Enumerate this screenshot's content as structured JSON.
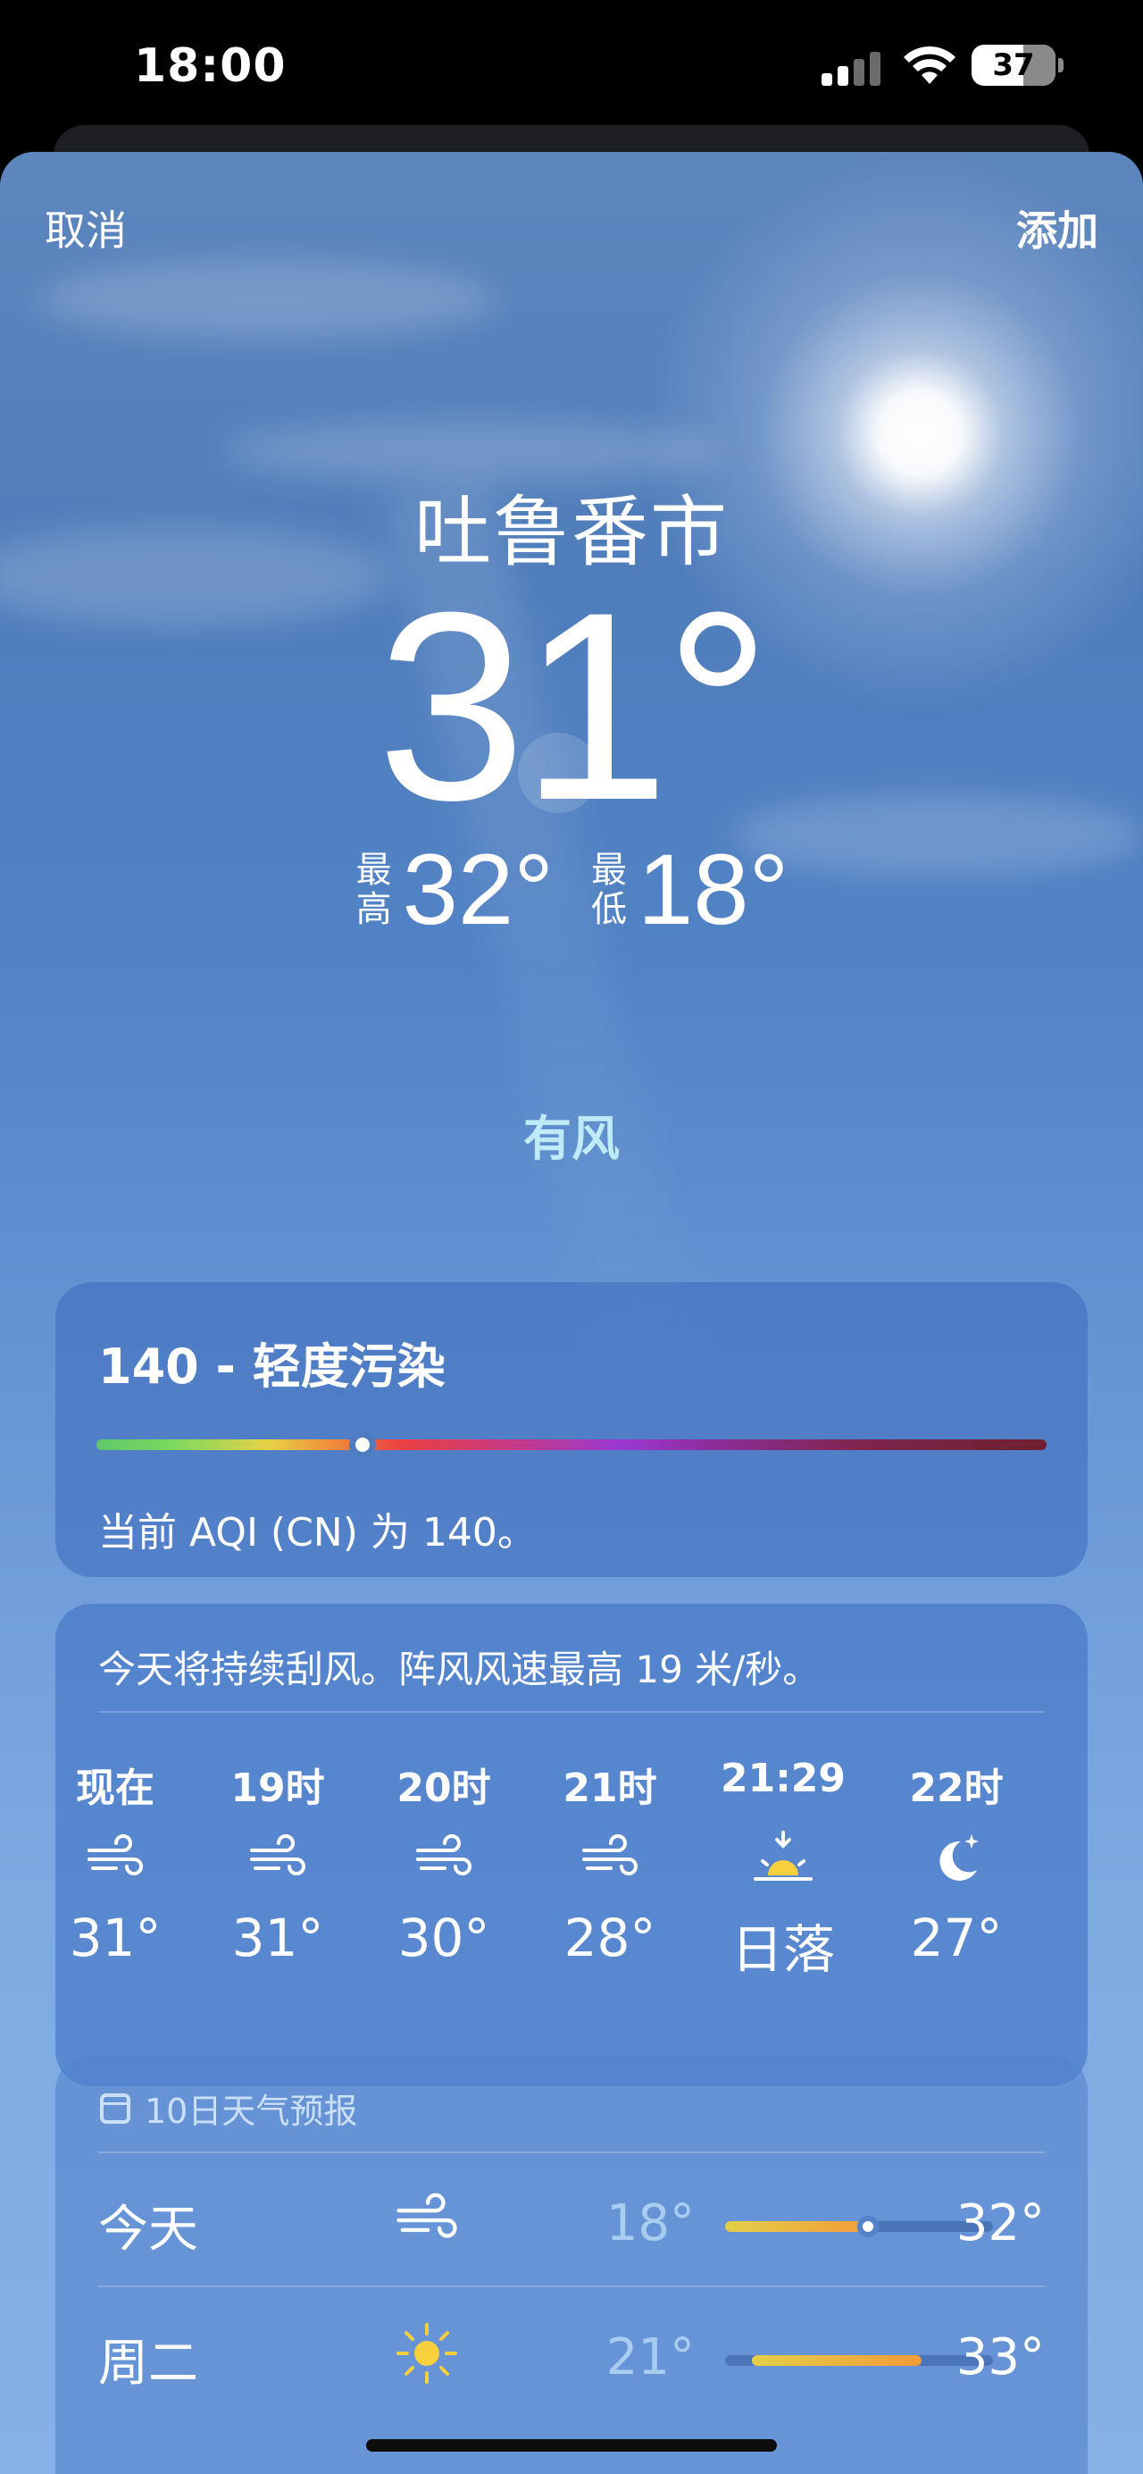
{
  "status_bar": {
    "time": "18:00",
    "battery": "37"
  },
  "nav": {
    "cancel": "取消",
    "add": "添加"
  },
  "location": {
    "city": "吐鲁番市",
    "temperature": "31°",
    "high_label": "最高",
    "high": "32°",
    "low_label": "最低",
    "low": "18°",
    "condition": "有风"
  },
  "aqi": {
    "title": "140 - 轻度污染",
    "description": "当前 AQI (CN) 为 140。",
    "level": 0.28
  },
  "hourly": {
    "summary": "今天将持续刮风。阵风风速最高 19 米/秒。",
    "items": [
      {
        "time": "现在",
        "icon": "wind-icon",
        "temp": "31°"
      },
      {
        "time": "19时",
        "icon": "wind-icon",
        "temp": "31°"
      },
      {
        "time": "20时",
        "icon": "wind-icon",
        "temp": "30°"
      },
      {
        "time": "21时",
        "icon": "wind-icon",
        "temp": "28°"
      },
      {
        "time": "21:29",
        "icon": "sunset-icon",
        "temp": "日落"
      },
      {
        "time": "22时",
        "icon": "moon-stars-icon",
        "temp": "27°"
      }
    ]
  },
  "daily": {
    "header": "10日天气预报",
    "days": [
      {
        "name": "今天",
        "icon": "wind-icon",
        "low": "18°",
        "high": "32°"
      },
      {
        "name": "周二",
        "icon": "sun-icon",
        "low": "21°",
        "high": "33°"
      }
    ]
  },
  "colors": {
    "sheet_top": "#5d86bd",
    "sheet_bottom": "#86b1e6",
    "condition_text": "#bfeaf7",
    "card": "#4070be"
  }
}
